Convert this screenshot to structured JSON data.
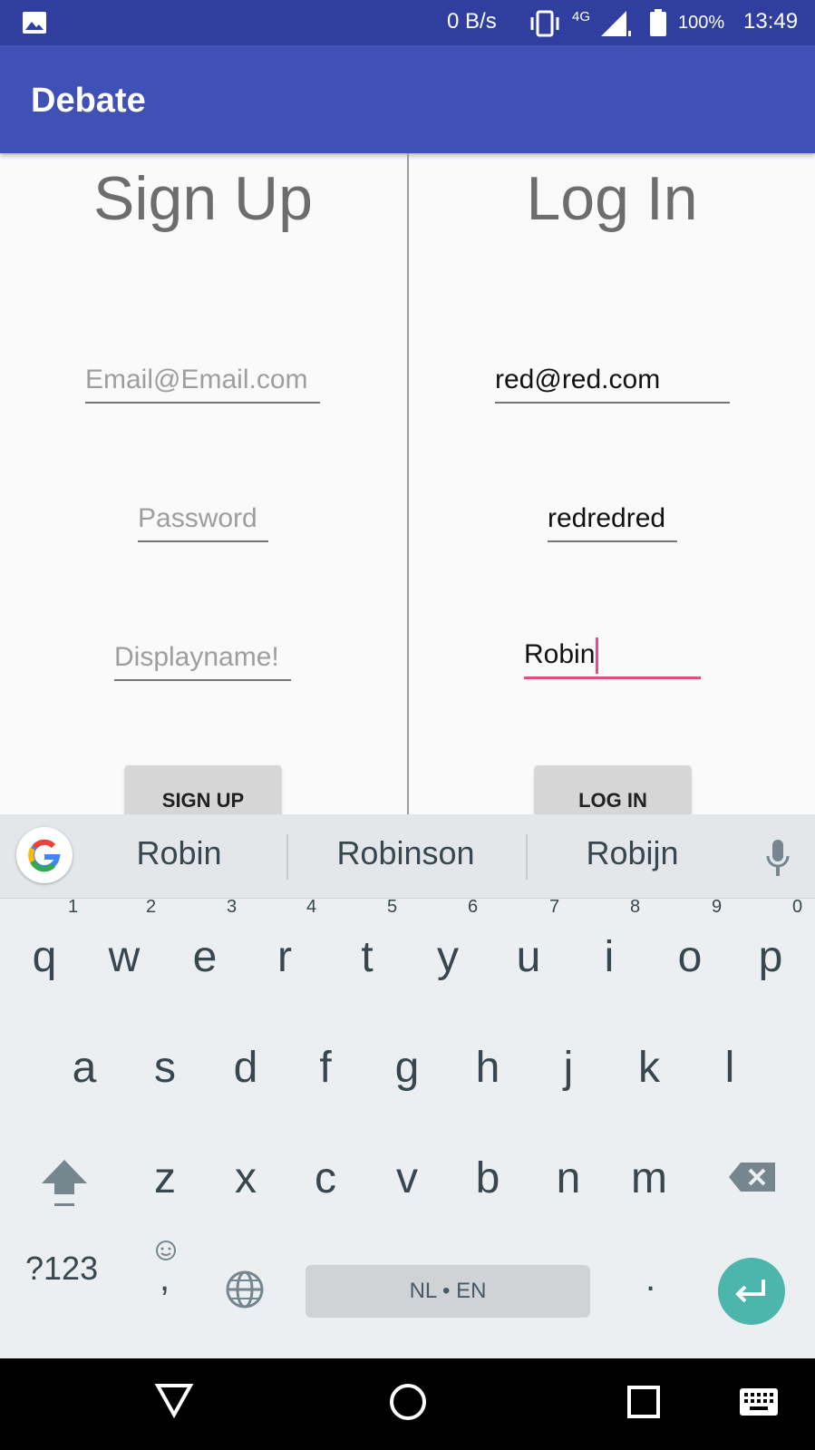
{
  "status_bar": {
    "network_speed": "0 B/s",
    "network_type": "4G",
    "battery": "100%",
    "time": "13:49"
  },
  "app_bar": {
    "title": "Debate"
  },
  "signup": {
    "heading": "Sign Up",
    "email_placeholder": "Email@Email.com",
    "password_placeholder": "Password",
    "displayname_placeholder": "Displayname!",
    "button_label": "SIGN UP"
  },
  "login": {
    "heading": "Log In",
    "email_value": "red@red.com",
    "password_value": "redredred",
    "displayname_value": "Robin",
    "button_label": "LOG IN"
  },
  "keyboard": {
    "suggestions": [
      "Robin",
      "Robinson",
      "Robijn"
    ],
    "row1": [
      {
        "key": "q",
        "num": "1"
      },
      {
        "key": "w",
        "num": "2"
      },
      {
        "key": "e",
        "num": "3"
      },
      {
        "key": "r",
        "num": "4"
      },
      {
        "key": "t",
        "num": "5"
      },
      {
        "key": "y",
        "num": "6"
      },
      {
        "key": "u",
        "num": "7"
      },
      {
        "key": "i",
        "num": "8"
      },
      {
        "key": "o",
        "num": "9"
      },
      {
        "key": "p",
        "num": "0"
      }
    ],
    "row2": [
      "a",
      "s",
      "d",
      "f",
      "g",
      "h",
      "j",
      "k",
      "l"
    ],
    "row3": [
      "z",
      "x",
      "c",
      "v",
      "b",
      "n",
      "m"
    ],
    "symbols_label": "?123",
    "comma": ",",
    "period": ".",
    "space_label": "NL • EN",
    "accent_color": "#4db6ac"
  },
  "colors": {
    "primary": "#3f51b5",
    "primary_dark": "#303f9f",
    "focus": "#e04e84"
  },
  "icons": [
    "gallery-icon",
    "vibrate-icon",
    "signal-icon",
    "battery-icon",
    "google-icon",
    "microphone-icon",
    "shift-icon",
    "backspace-icon",
    "emoji-icon",
    "globe-icon",
    "enter-icon",
    "back-icon",
    "home-icon",
    "recents-icon",
    "keyboard-icon"
  ]
}
